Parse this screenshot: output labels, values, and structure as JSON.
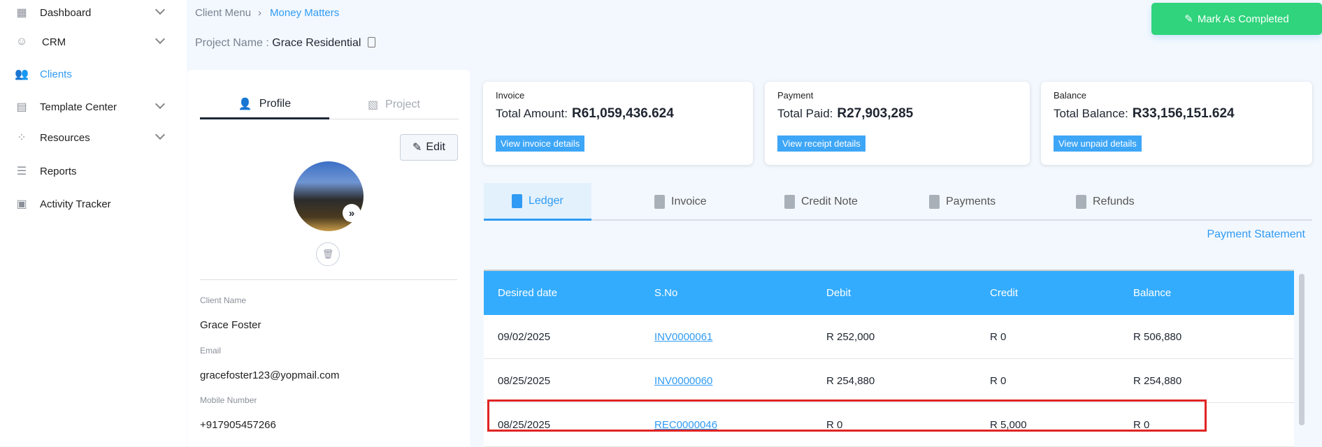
{
  "sidebar": {
    "items": [
      {
        "label": "Dashboard",
        "icon": "dashboard-icon"
      },
      {
        "label": "CRM",
        "icon": "crm-icon"
      },
      {
        "label": "Clients",
        "icon": "clients-icon",
        "active": true
      },
      {
        "label": "Template Center",
        "icon": "template-icon"
      },
      {
        "label": "Resources",
        "icon": "resources-icon"
      },
      {
        "label": "Reports",
        "icon": "reports-icon"
      },
      {
        "label": "Activity Tracker",
        "icon": "activity-icon"
      }
    ]
  },
  "breadcrumb": {
    "parent": "Client Menu",
    "current": "Money Matters"
  },
  "project": {
    "label": "Project Name :",
    "name": "Grace Residential"
  },
  "mark_completed": "Mark As Completed",
  "profile": {
    "tabs": [
      "Profile",
      "Project"
    ],
    "edit": "Edit",
    "fields": [
      {
        "label": "Client Name",
        "value": "Grace Foster"
      },
      {
        "label": "Email",
        "value": "gracefoster123@yopmail.com"
      },
      {
        "label": "Mobile Number",
        "value": "+917905457266"
      }
    ]
  },
  "cards": [
    {
      "title": "Invoice",
      "label": "Total Amount:",
      "amount": "R61,059,436.624",
      "button": "View invoice details"
    },
    {
      "title": "Payment",
      "label": "Total Paid:",
      "amount": "R27,903,285",
      "button": "View receipt details"
    },
    {
      "title": "Balance",
      "label": "Total Balance:",
      "amount": "R33,156,151.624",
      "button": "View unpaid details"
    }
  ],
  "tabs": [
    "Ledger",
    "Invoice",
    "Credit Note",
    "Payments",
    "Refunds"
  ],
  "payment_statement": "Payment Statement",
  "table": {
    "headers": [
      "Desired date",
      "S.No",
      "Debit",
      "Credit",
      "Balance"
    ],
    "rows": [
      [
        "09/02/2025",
        "INV0000061",
        "R 252,000",
        "R 0",
        "R 506,880"
      ],
      [
        "08/25/2025",
        "INV0000060",
        "R 254,880",
        "R 0",
        "R 254,880"
      ],
      [
        "08/25/2025",
        "REC0000046",
        "R 0",
        "R 5,000",
        "R 0"
      ]
    ]
  },
  "colors": {
    "accent": "#2f9bf4",
    "success": "#2fd47c",
    "header": "#34acfe",
    "highlight": "#e02424"
  }
}
